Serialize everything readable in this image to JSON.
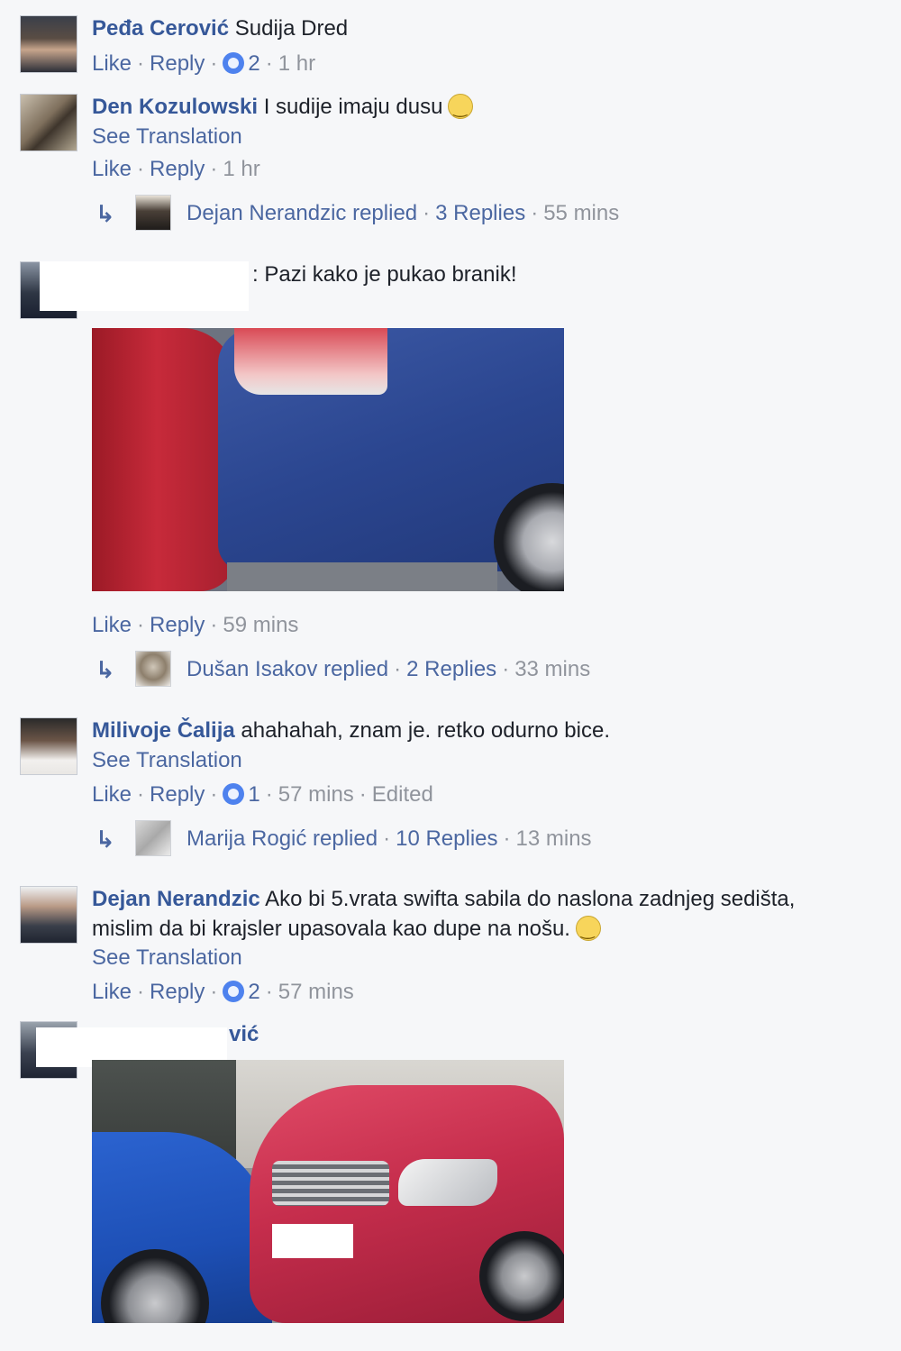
{
  "comments": [
    {
      "author": "Peđa Cerović",
      "text": "Sudija Dred",
      "like": "Like",
      "reply": "Reply",
      "reactions": "2",
      "time": "1 hr"
    },
    {
      "author": "Den Kozulowski",
      "text": "I sudije imaju dusu",
      "see_translation": "See Translation",
      "like": "Like",
      "reply": "Reply",
      "time": "1 hr",
      "replies_summary": {
        "replier": "Dejan Nerandzic replied",
        "count": "3 Replies",
        "time": "55 mins"
      }
    },
    {
      "author": "",
      "text": ": Pazi kako je pukao branik!",
      "like": "Like",
      "reply": "Reply",
      "time": "59 mins",
      "replies_summary": {
        "replier": "Dušan Isakov replied",
        "count": "2 Replies",
        "time": "33 mins"
      }
    },
    {
      "author": "Milivoje Čalija",
      "text": "ahahahah, znam je. retko odurno bice.",
      "see_translation": "See Translation",
      "like": "Like",
      "reply": "Reply",
      "reactions": "1",
      "time": "57 mins",
      "edited": "Edited",
      "replies_summary": {
        "replier": "Marija Rogić replied",
        "count": "10 Replies",
        "time": "13 mins"
      }
    },
    {
      "author": "Dejan Nerandzic",
      "text_line1": "Ako bi 5.vrata swifta sabila do naslona zadnjeg sedišta,",
      "text_line2": "mislim da bi krajsler upasovala kao dupe na nošu.",
      "see_translation": "See Translation",
      "like": "Like",
      "reply": "Reply",
      "reactions": "2",
      "time": "57 mins"
    },
    {
      "author_partial": "vić"
    }
  ],
  "colors": {
    "name": "#365899",
    "meta": "#90949c",
    "background": "#f6f7f9",
    "like_badge": "#4e82ee"
  },
  "icons": [
    "like-reaction-icon",
    "smile-emoji-icon",
    "reply-arrow-icon"
  ]
}
